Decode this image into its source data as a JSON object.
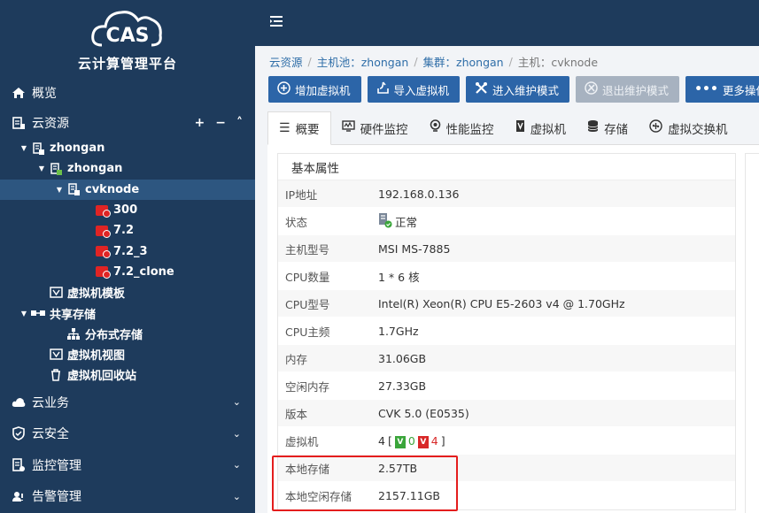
{
  "brand": {
    "logo_text": "CAS",
    "title": "云计算管理平台"
  },
  "sidebar": {
    "overview": "概览",
    "cloud_resources": "云资源",
    "tools": [
      "+",
      "−",
      "˄"
    ],
    "tree": [
      {
        "label": "zhongan",
        "level": 0,
        "icon": "host-pool-icon"
      },
      {
        "label": "zhongan",
        "level": 1,
        "icon": "cluster-icon"
      },
      {
        "label": "cvknode",
        "level": 2,
        "icon": "host-icon"
      },
      {
        "label": "300",
        "level": 3,
        "icon": "vm-stopped-icon"
      },
      {
        "label": "7.2",
        "level": 3,
        "icon": "vm-stopped-icon"
      },
      {
        "label": "7.2_3",
        "level": 3,
        "icon": "vm-stopped-icon"
      },
      {
        "label": "7.2_clone",
        "level": 3,
        "icon": "vm-stopped-icon"
      },
      {
        "label": "虚拟机模板",
        "level": 1,
        "icon": "template-icon"
      },
      {
        "label": "共享存储",
        "level": 0,
        "icon": "shared-storage-icon"
      },
      {
        "label": "分布式存储",
        "level": 2,
        "icon": "distributed-storage-icon"
      },
      {
        "label": "虚拟机视图",
        "level": 1,
        "icon": "vm-view-icon"
      },
      {
        "label": "虚拟机回收站",
        "level": 1,
        "icon": "trash-icon"
      }
    ],
    "bottom": [
      "云业务",
      "云安全",
      "监控管理",
      "告警管理"
    ]
  },
  "breadcrumb": [
    "云资源",
    "主机池：zhongan",
    "集群：zhongan",
    "主机：cvknode"
  ],
  "toolbar": [
    {
      "label": "增加虚拟机",
      "icon": "plus-circle-icon",
      "disabled": false
    },
    {
      "label": "导入虚拟机",
      "icon": "import-icon",
      "disabled": false
    },
    {
      "label": "进入维护模式",
      "icon": "wrench-icon",
      "disabled": false
    },
    {
      "label": "退出维护模式",
      "icon": "exit-maintenance-icon",
      "disabled": true
    },
    {
      "label": "更多操作",
      "icon": "more-icon",
      "disabled": false
    }
  ],
  "tabs": [
    "概要",
    "硬件监控",
    "性能监控",
    "虚拟机",
    "存储",
    "虚拟交换机"
  ],
  "panel": {
    "title": "基本属性",
    "rows": [
      {
        "k": "IP地址",
        "v": "192.168.0.136"
      },
      {
        "k": "状态",
        "v": "正常"
      },
      {
        "k": "主机型号",
        "v": "MSI MS-7885"
      },
      {
        "k": "CPU数量",
        "v": "1 * 6 核"
      },
      {
        "k": "CPU型号",
        "v": "Intel(R) Xeon(R) CPU E5-2603 v4 @ 1.70GHz"
      },
      {
        "k": "CPU主频",
        "v": "1.7GHz"
      },
      {
        "k": "内存",
        "v": "31.06GB"
      },
      {
        "k": "空闲内存",
        "v": "27.33GB"
      },
      {
        "k": "版本",
        "v": "CVK 5.0 (E0535)"
      },
      {
        "k": "虚拟机",
        "v": "4",
        "running": "0",
        "stopped": "4"
      },
      {
        "k": "本地存储",
        "v": "2.57TB"
      },
      {
        "k": "本地空闲存储",
        "v": "2157.11GB"
      }
    ]
  },
  "colors": {
    "sidebar": "#1e3b5c",
    "button": "#2c65a8",
    "highlight": "#e41d1d"
  }
}
